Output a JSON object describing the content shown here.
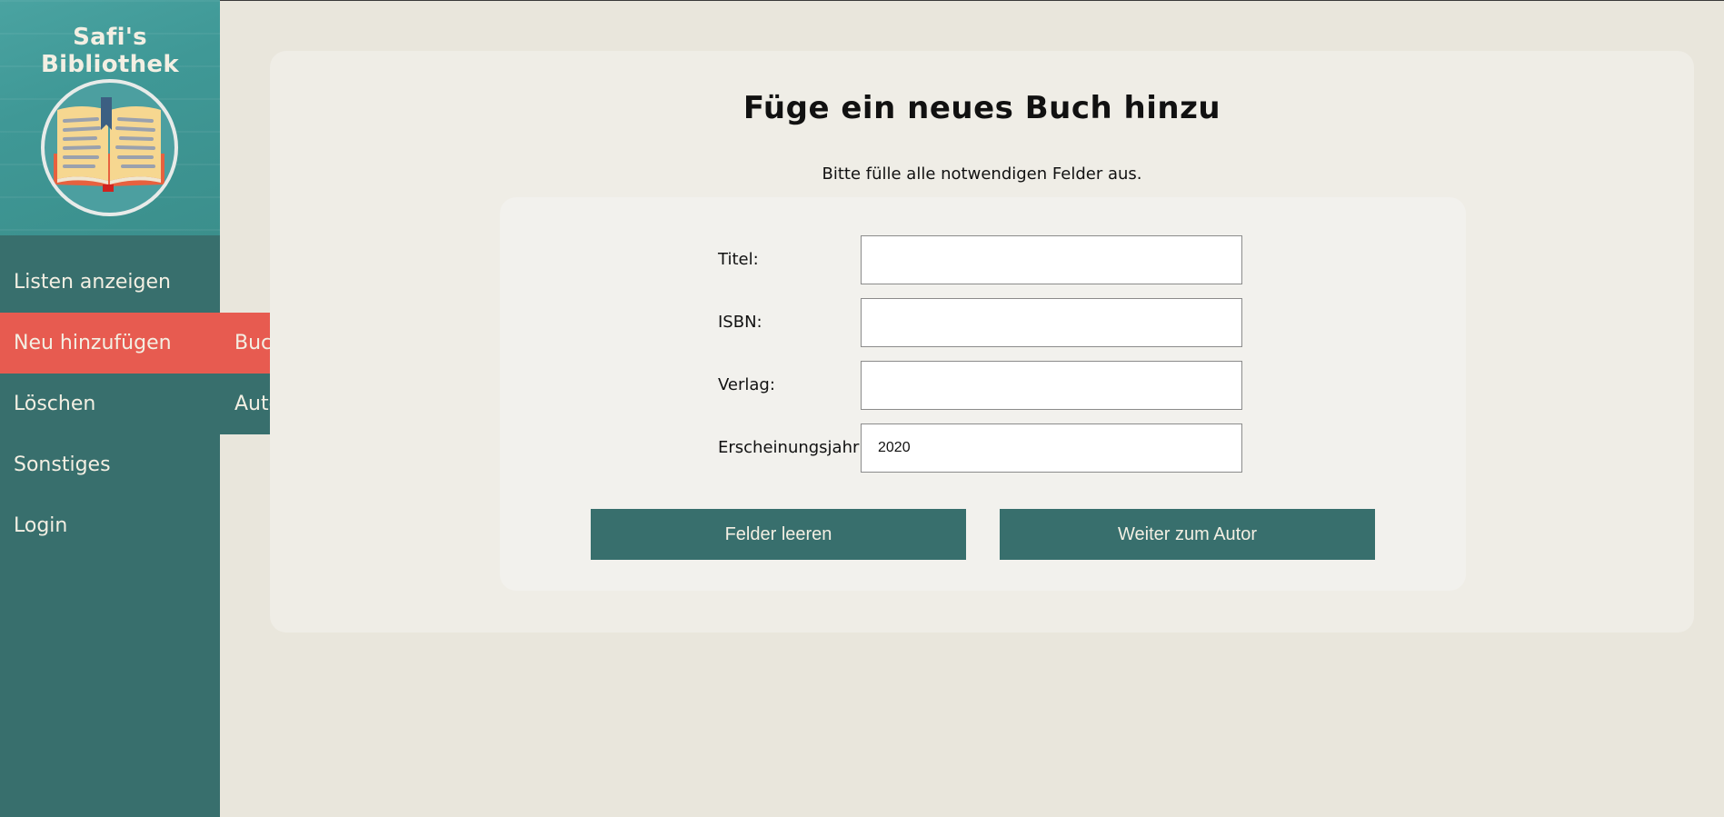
{
  "sidebar": {
    "title": "Safi's Bibliothek",
    "logo_icon": "open-book-icon",
    "items": [
      {
        "label": "Listen anzeigen"
      },
      {
        "label": "Neu hinzufügen"
      },
      {
        "label": "Löschen"
      },
      {
        "label": "Sonstiges"
      },
      {
        "label": "Login"
      }
    ],
    "submenu": [
      {
        "label": "Buch hinzufügen"
      },
      {
        "label": "Autor hinzufügen"
      }
    ]
  },
  "main": {
    "title": "Füge ein neues Buch hinzu",
    "subtitle": "Bitte fülle alle notwendigen Felder aus.",
    "form": {
      "title_label": "Titel:",
      "title_value": "",
      "isbn_label": "ISBN:",
      "isbn_value": "",
      "publisher_label": "Verlag:",
      "publisher_value": "",
      "year_label": "Erscheinungsjahr:",
      "year_value": "2020"
    },
    "buttons": {
      "clear": "Felder leeren",
      "next": "Weiter zum Autor"
    }
  },
  "colors": {
    "sidebar": "#386f6d",
    "active": "#e75b50",
    "page_bg": "#e9e6dc",
    "card_bg": "#efede6",
    "button": "#386f6d"
  }
}
